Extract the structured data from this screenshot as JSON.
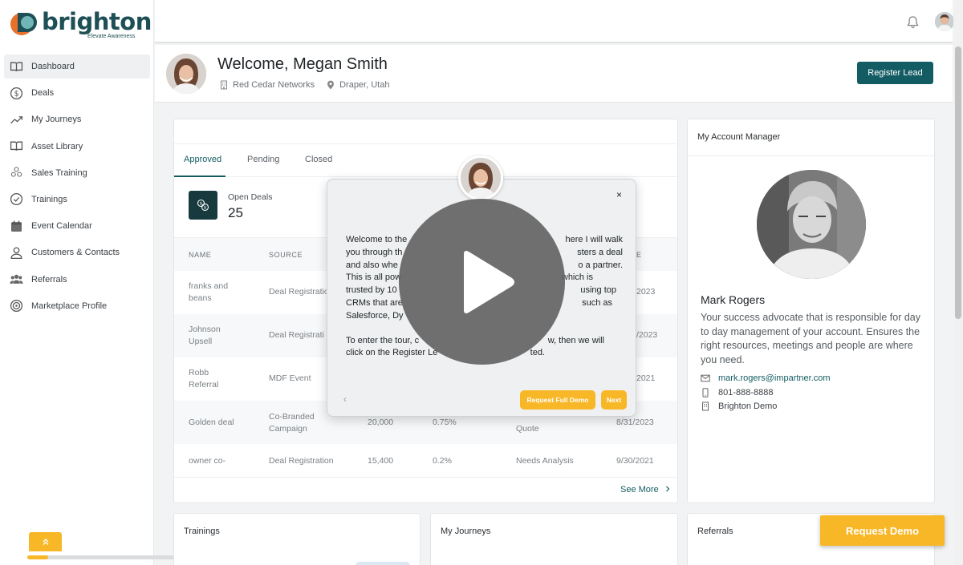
{
  "brand": {
    "name": "brighton",
    "tagline": "Elevate Awareness",
    "colors": {
      "teal": "#135c63",
      "yellow": "#f8b727"
    }
  },
  "sidebar": {
    "items": [
      {
        "label": "Dashboard",
        "icon": "book-icon"
      },
      {
        "label": "Deals",
        "icon": "dollar-circle-icon"
      },
      {
        "label": "My Journeys",
        "icon": "trend-icon"
      },
      {
        "label": "Asset Library",
        "icon": "open-book-icon"
      },
      {
        "label": "Sales Training",
        "icon": "training-icon"
      },
      {
        "label": "Trainings",
        "icon": "check-circle-icon"
      },
      {
        "label": "Event Calendar",
        "icon": "calendar-icon"
      },
      {
        "label": "Customers & Contacts",
        "icon": "contacts-icon"
      },
      {
        "label": "Referrals",
        "icon": "group-icon"
      },
      {
        "label": "Marketplace Profile",
        "icon": "target-icon"
      }
    ]
  },
  "header": {
    "welcome": "Welcome, Megan Smith",
    "company": "Red Cedar Networks",
    "location": "Draper, Utah",
    "register_label": "Register Lead"
  },
  "deals": {
    "tabs": [
      "Approved",
      "Pending",
      "Closed"
    ],
    "stat_label": "Open Deals",
    "stat_value": "25",
    "columns": [
      "NAME",
      "SOURCE",
      "E"
    ],
    "rows": [
      {
        "name": "franks and beans",
        "source": "Deal Registratio",
        "amount": "",
        "prob": "",
        "stage": "",
        "date": "2023"
      },
      {
        "name": "Johnson Upsell",
        "source": "Deal Registrati",
        "amount": "",
        "prob": "",
        "stage": "",
        "date": "/2023"
      },
      {
        "name": "Robb Referral",
        "source": "MDF Event",
        "amount": "",
        "prob": "",
        "stage": "",
        "date": "2021"
      },
      {
        "name": "Golden deal",
        "source": "Co-Branded Campaign",
        "amount": "20,000",
        "prob": "0.75%",
        "stage": "Quote",
        "date": "8/31/2023"
      },
      {
        "name": "owner co-",
        "source": "Deal Registration",
        "amount": "15,400",
        "prob": "0.2%",
        "stage": "Needs Analysis",
        "date": "9/30/2021"
      }
    ],
    "see_more": "See More"
  },
  "account_manager": {
    "title": "My Account Manager",
    "name": "Mark Rogers",
    "description": "Your success advocate that is responsible for day to day management of your account. Ensures the right resources, meetings and people are where you need.",
    "email": "mark.rogers@impartner.com",
    "phone": "801-888-8888",
    "company": "Brighton Demo"
  },
  "bottom": {
    "trainings": "Trainings",
    "journeys": "My Journeys",
    "referrals": "Referrals"
  },
  "request_demo": "Request Demo",
  "tour": {
    "text1": "Welcome to the",
    "text1b": "here I will walk",
    "text2": "you through th",
    "text2b": "sters a deal",
    "text3": "and also whe",
    "text3b": "o a partner.",
    "text4": "This is all pow",
    "text4b": "which is",
    "text5": "trusted by 10",
    "text5b": "using top",
    "text6": "CRMs that are",
    "text6b": "such as",
    "text7": "Salesforce, Dy",
    "text8": "To enter the tour, c",
    "text8b": "w, then we will",
    "text9": "click on the Register Le",
    "text9b": "ted.",
    "prev": "‹",
    "full_demo": "Request Full Demo",
    "next": "Next",
    "close": "×"
  }
}
